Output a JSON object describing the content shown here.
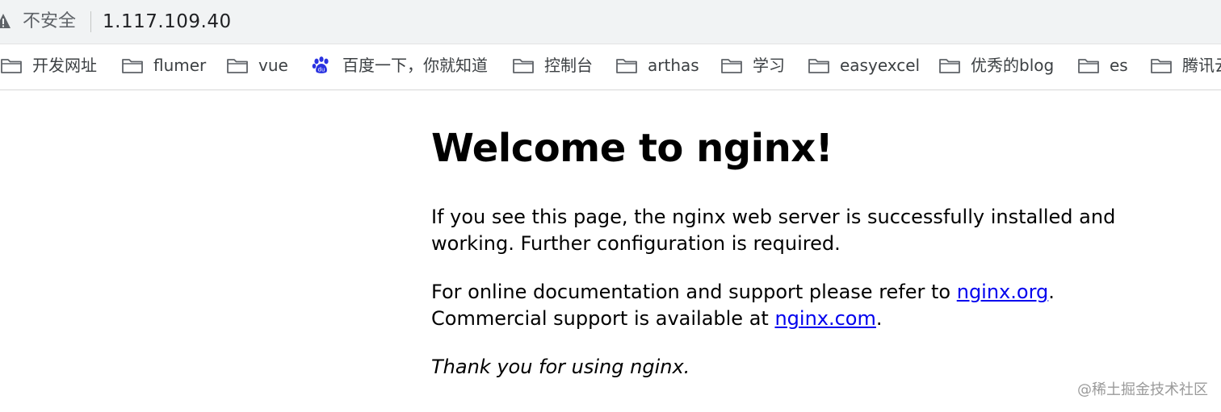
{
  "address_bar": {
    "security_label": "不安全",
    "url": "1.117.109.40",
    "warning_icon": "warning-triangle-icon"
  },
  "bookmarks": [
    {
      "label": "开发网址",
      "icon": "folder-icon"
    },
    {
      "label": "flumer",
      "icon": "folder-icon"
    },
    {
      "label": "vue",
      "icon": "folder-icon"
    },
    {
      "label": "百度一下，你就知道",
      "icon": "baidu-paw-icon"
    },
    {
      "label": "控制台",
      "icon": "folder-icon"
    },
    {
      "label": "arthas",
      "icon": "folder-icon"
    },
    {
      "label": "学习",
      "icon": "folder-icon"
    },
    {
      "label": "easyexcel",
      "icon": "folder-icon"
    },
    {
      "label": "优秀的blog",
      "icon": "folder-icon"
    },
    {
      "label": "es",
      "icon": "folder-icon"
    },
    {
      "label": "腾讯云",
      "icon": "folder-icon"
    }
  ],
  "page": {
    "heading": "Welcome to nginx!",
    "p1_line1": "If you see this page, the nginx web server is successfully installed and",
    "p1_line2": "working. Further configuration is required.",
    "p2_line1_prefix": "For online documentation and support please refer to ",
    "p2_link1": "nginx.org",
    "p2_line1_suffix": ".",
    "p2_line2_prefix": "Commercial support is available at ",
    "p2_link2": "nginx.com",
    "p2_line2_suffix": ".",
    "p3": "Thank you for using nginx."
  },
  "watermark": "@稀土掘金技术社区",
  "colors": {
    "link": "#0000ee",
    "address_bar_bg": "#f1f3f4",
    "baidu_blue": "#2932e1"
  }
}
